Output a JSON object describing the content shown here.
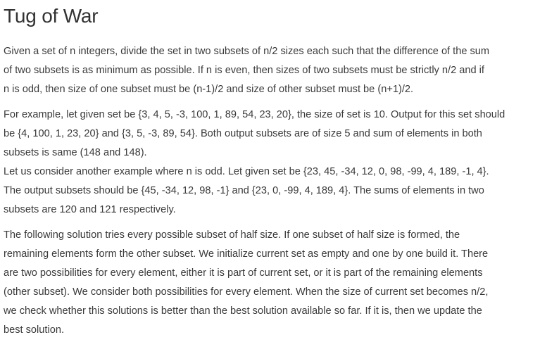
{
  "article": {
    "title": "Tug of War",
    "paragraphs": [
      {
        "lines": [
          "Given a set of n integers, divide the set in two subsets of n/2 sizes each such that the difference of the sum",
          "of two subsets is as minimum as possible. If n is even, then sizes of two subsets must be strictly n/2 and if",
          "n is odd, then size of one subset must be (n-1)/2 and size of other subset must be (n+1)/2."
        ]
      },
      {
        "lines": [
          "For example, let given set be {3, 4, 5, -3, 100, 1, 89, 54, 23, 20}, the size of set is 10. Output for this set should",
          "be {4, 100, 1, 23, 20} and {3, 5, -3, 89, 54}. Both output subsets are of size 5 and sum of elements in both",
          "subsets is same (148 and 148)."
        ]
      },
      {
        "lines": [
          "Let us consider another example where n is odd. Let given set be {23, 45, -34, 12, 0, 98, -99, 4, 189, -1, 4}.",
          "The output subsets should be {45, -34, 12, 98, -1} and {23, 0, -99, 4, 189, 4}. The sums of elements in two",
          "subsets are 120 and 121 respectively."
        ]
      },
      {
        "lines": [
          "The following solution tries every possible subset of half size. If one subset of half size is formed, the",
          "remaining elements form the other subset. We initialize current set as empty and one by one build it. There",
          "are two possibilities for every element, either it is part of current set, or it is part of the remaining elements",
          "(other subset). We consider both possibilities for every element. When the size of current set becomes n/2,",
          "we check whether this solutions is better than the best solution available so far. If it is, then we update the",
          "best solution."
        ]
      }
    ]
  }
}
